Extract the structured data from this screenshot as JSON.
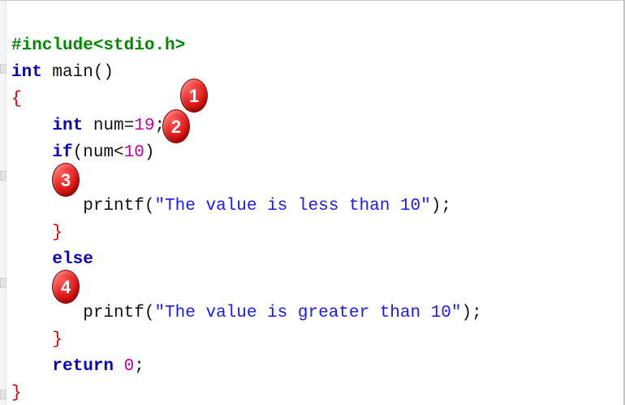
{
  "code": {
    "l1_pp": "#include",
    "l1_hdr": "<stdio.h>",
    "l2_kw": "int",
    "l2_fn": " main",
    "l2_paren": "()",
    "l3_brace": "{",
    "l4_indent": "    ",
    "l4_kw": "int",
    "l4_decl": " num=",
    "l4_num": "19",
    "l4_end": ";",
    "l5_indent": "    ",
    "l5_kw": "if",
    "l5_open": "(num<",
    "l5_ten": "10",
    "l5_close": ")",
    "l6_indent": "    ",
    "l6_brace": "{",
    "l7_indent": "       ",
    "l7_fn": "printf",
    "l7_open": "(",
    "l7_str": "\"The value is less than 10\"",
    "l7_close": ");",
    "l8_indent": "    ",
    "l8_brace": "}",
    "l9_indent": "    ",
    "l9_kw": "else",
    "l10_indent": "    ",
    "l10_brace": "{",
    "l11_indent": "       ",
    "l11_fn": "printf",
    "l11_open": "(",
    "l11_str": "\"The value is greater than 10\"",
    "l11_close": ");",
    "l12_indent": "    ",
    "l12_brace": "}",
    "l13_indent": "    ",
    "l13_kw": "return",
    "l13_sp": " ",
    "l13_num": "0",
    "l13_end": ";",
    "l14_brace": "}"
  },
  "badges": {
    "b1": "1",
    "b2": "2",
    "b3": "3",
    "b4": "4"
  }
}
